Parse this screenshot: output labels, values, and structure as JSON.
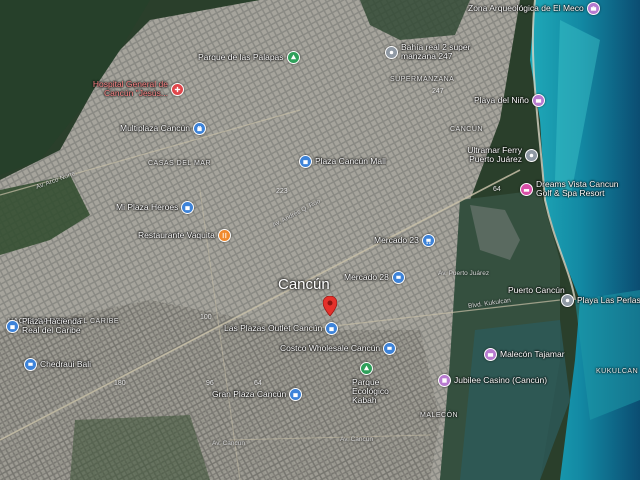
{
  "map": {
    "city_label": "Cancún",
    "colors": {
      "sea": "#1d8aa0",
      "sea_deep": "#0c4a6a",
      "lagoon": "#3b5a4a",
      "jungle": "#27402a",
      "urban": "#8a8a84",
      "shopping": "#3d83d9",
      "hospital": "#e0454a",
      "restaurant": "#f08a2c",
      "park": "#2ea05a",
      "attraction": "#b87ad0",
      "pin_red": "#e5312b",
      "generic": "#8f99a4"
    },
    "pois": [
      {
        "id": "zona-arqueologica",
        "label": "Zona Arqueológica de El Meco",
        "icon": "attraction",
        "side": "left"
      },
      {
        "id": "bahia-real",
        "label": "Bahía real 2 super manzana 247",
        "icon": "generic",
        "side": "right"
      },
      {
        "id": "parque-palapas",
        "label": "Parque de las Palapas",
        "icon": "park",
        "side": "left"
      },
      {
        "id": "hospital-general",
        "label": "Hospital General de Cancún \"Jesús...",
        "icon": "hospital",
        "side": "left"
      },
      {
        "id": "playa-nino",
        "label": "Playa del Niño",
        "icon": "attraction",
        "side": "left"
      },
      {
        "id": "multiplaza",
        "label": "Multiplaza Cancún",
        "icon": "shopping",
        "side": "left"
      },
      {
        "id": "plaza-cancun-mall",
        "label": "Plaza Cancún Mall",
        "icon": "shopping",
        "side": "right"
      },
      {
        "id": "ultramar",
        "label": "Ultramar Ferry Puerto Juárez",
        "icon": "generic",
        "side": "left"
      },
      {
        "id": "dreams-vista",
        "label": "Dreams Vista Cancun Golf & Spa Resort",
        "icon": "attraction",
        "side": "right"
      },
      {
        "id": "mi-plaza-heroes",
        "label": "Mi Plaza Heroes",
        "icon": "shopping",
        "side": "left"
      },
      {
        "id": "restaurante-vaquita",
        "label": "Restaurante Vaquita",
        "icon": "restaurant",
        "side": "left"
      },
      {
        "id": "mercado-23",
        "label": "Mercado 23",
        "icon": "shopping",
        "side": "left"
      },
      {
        "id": "mercado-28",
        "label": "Mercado 28",
        "icon": "shopping",
        "side": "left"
      },
      {
        "id": "puerto-cancun",
        "label": "Puerto Cancún",
        "icon": "none",
        "side": "none"
      },
      {
        "id": "playa-perlas",
        "label": "Playa Las Perlas",
        "icon": "generic",
        "side": "right"
      },
      {
        "id": "plaza-hacienda",
        "label": "Plaza Hacienda Real del Caribe",
        "icon": "shopping",
        "side": "right"
      },
      {
        "id": "las-plazas-outlet",
        "label": "Las Plazas Outlet Cancún",
        "icon": "shopping",
        "side": "right"
      },
      {
        "id": "costco",
        "label": "Costco Wholesale Cancún",
        "icon": "shopping",
        "side": "left"
      },
      {
        "id": "malecon-tajamar",
        "label": "Malecón Tajamar",
        "icon": "attraction",
        "side": "right"
      },
      {
        "id": "chedraui",
        "label": "Chedraui Bali",
        "icon": "shopping",
        "side": "right"
      },
      {
        "id": "parque-kabah",
        "label": "Parque Ecológico Kabah",
        "icon": "park",
        "side": "below"
      },
      {
        "id": "jubilee",
        "label": "Jubilee Casino (Cancún)",
        "icon": "attraction",
        "side": "right"
      },
      {
        "id": "gran-plaza",
        "label": "Gran Plaza Cancún",
        "icon": "shopping",
        "side": "left"
      }
    ],
    "areas": [
      "CASAS DEL MAR",
      "CANCÚN",
      "SUPERMANZANA",
      "HACIENDA REAL DEL CARIBE",
      "MALECÓN",
      "KUKULCAN"
    ],
    "roads": [
      "Av. Arco Norte",
      "Av. Andrés Q. Roo",
      "Blvd. Kukulcan",
      "Av. Cancún",
      "Av. Puerto Juárez",
      "Av. Cancún"
    ],
    "route_numbers": [
      "247",
      "64",
      "223",
      "100",
      "180",
      "64",
      "96"
    ]
  }
}
